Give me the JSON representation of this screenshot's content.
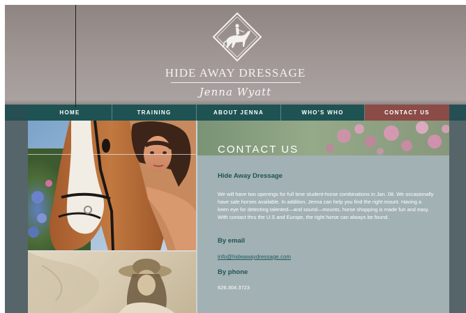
{
  "brand": {
    "title": "HIDE AWAY DRESSAGE",
    "signature": "Jenna Wyatt"
  },
  "nav": {
    "items": [
      {
        "label": "HOME"
      },
      {
        "label": "TRAINING"
      },
      {
        "label": "ABOUT JENNA"
      },
      {
        "label": "WHO'S WHO"
      },
      {
        "label": "CONTACT US"
      }
    ],
    "active_color": "#8b4b47",
    "bar_color": "#1f5353"
  },
  "page": {
    "banner_title": "CONTACT US",
    "section_title": "Hide Away Dressage",
    "intro": "We will have two openings for full time student-horse combinations in Jan. 08. We occasionally have sale horses available. In addition, Jenna can help you find the right mount. Having a keen eye for detecting talented—and sound—mounts, horse shopping is made fun and easy. With contact thru the U.S and Europe, the right horse can always be found.",
    "email_heading": "By email",
    "email": "info@hideawaydressage.com",
    "phone_heading": "By phone",
    "phone": "626.304.3723"
  },
  "colors": {
    "header": "#9e9593",
    "background": "#56656a",
    "content_panel": "#a2b1b4",
    "heading": "#1f5353"
  }
}
